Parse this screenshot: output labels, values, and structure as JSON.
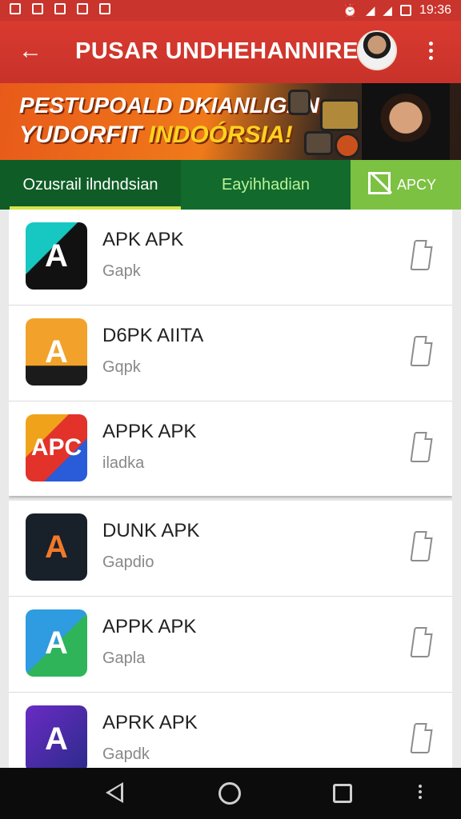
{
  "status_bar": {
    "time": "19:36"
  },
  "app_bar": {
    "title": "PUSAR UNDHEHANNIRE"
  },
  "banner": {
    "line1": "PESTUPOALD DKIANLIGAN",
    "line2_white": "YUDORFIT",
    "line2_yellow": "INDOÓRSIA!"
  },
  "tabs": [
    {
      "label": "Ozusrail ilndndsian"
    },
    {
      "label": "Eayihhadian"
    },
    {
      "label": "APCY"
    }
  ],
  "apps": [
    {
      "name": "APK APK",
      "sub": "Gapk",
      "icon": "app-a-icon"
    },
    {
      "name": "D6PK AIITA",
      "sub": "Gqpk",
      "icon": "app-b-icon"
    },
    {
      "name": "APPK APK",
      "sub": "iladka",
      "icon": "app-c-icon"
    },
    {
      "name": "DUNK APK",
      "sub": "Gapdio",
      "icon": "app-d-icon"
    },
    {
      "name": "APPK APK",
      "sub": "Gapla",
      "icon": "app-e-icon"
    },
    {
      "name": "APRK APK",
      "sub": "Gapdk",
      "icon": "app-f-icon"
    }
  ]
}
